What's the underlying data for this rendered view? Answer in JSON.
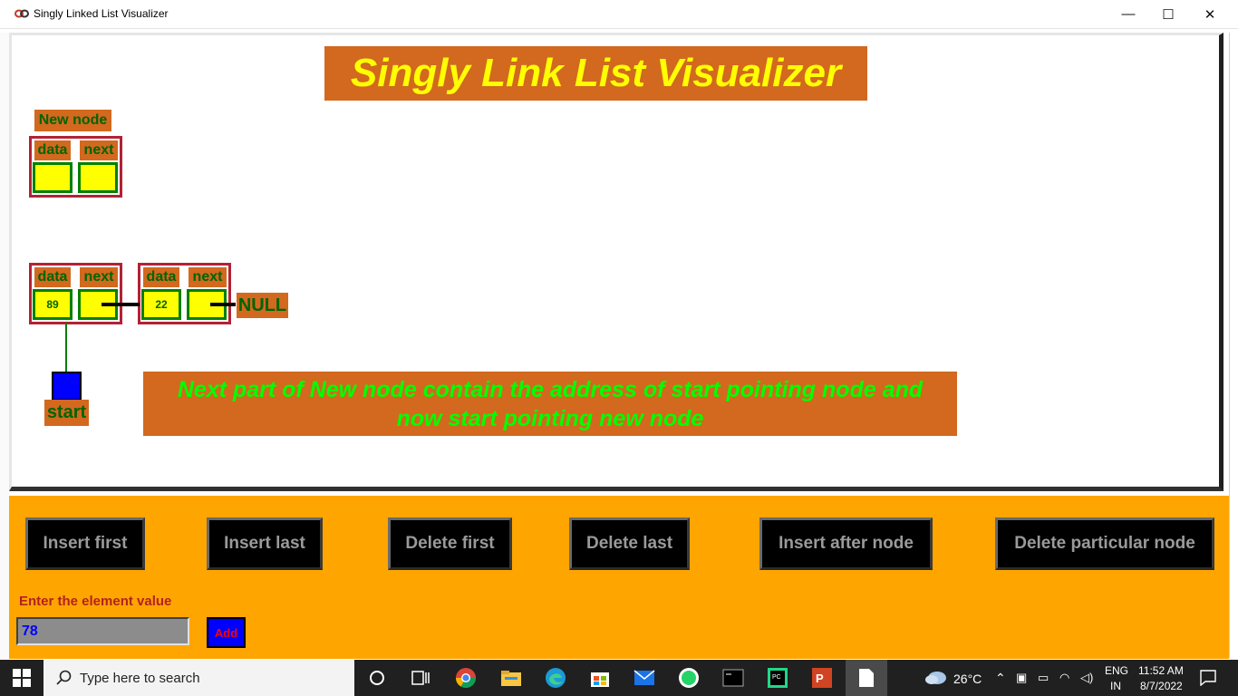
{
  "window": {
    "title": "Singly Linked List Visualizer",
    "minimize": "—",
    "maximize": "☐",
    "close": "✕"
  },
  "canvas": {
    "heading": "Singly Link List Visualizer",
    "new_node": {
      "label": "New node",
      "data_header": "data",
      "next_header": "next",
      "data_value": "",
      "next_value": ""
    },
    "nodes": [
      {
        "data_header": "data",
        "next_header": "next",
        "data_value": "89"
      },
      {
        "data_header": "data",
        "next_header": "next",
        "data_value": "22"
      }
    ],
    "null_label": "NULL",
    "start_label": "start",
    "message_line1": "Next part of New node contain the address of start pointing node and",
    "message_line2": "now start pointing new node"
  },
  "controls": {
    "buttons": [
      "Insert first",
      "Insert last",
      "Delete first",
      "Delete last",
      "Insert after node",
      "Delete particular node"
    ],
    "input_label": "Enter the element value",
    "input_value": "78",
    "add_label": "Add"
  },
  "taskbar": {
    "search_placeholder": "Type here to search",
    "weather": "26°C",
    "lang_top": "ENG",
    "lang_bottom": "IN",
    "time": "11:52 AM",
    "date": "8/7/2022"
  },
  "colors": {
    "orange_label": "#d2691e",
    "panel": "#ffa500",
    "heading_text": "#ffff00",
    "message_text": "#00ff00",
    "node_border": "#b22234",
    "cell_fill": "#ffff00",
    "start_box": "#0000ff"
  }
}
